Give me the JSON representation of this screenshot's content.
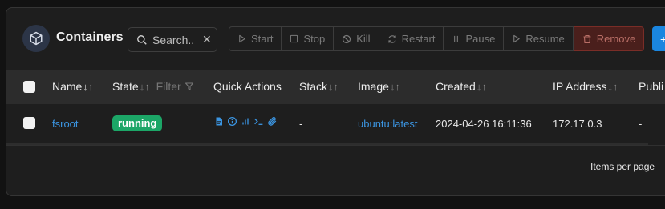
{
  "header": {
    "title": "Containers",
    "title_icon": "cube-icon",
    "search": {
      "placeholder": "Search..",
      "value": ""
    },
    "actions": [
      {
        "label": "Start",
        "icon": "play-icon"
      },
      {
        "label": "Stop",
        "icon": "square-icon"
      },
      {
        "label": "Kill",
        "icon": "ban-icon"
      },
      {
        "label": "Restart",
        "icon": "refresh-icon"
      },
      {
        "label": "Pause",
        "icon": "pause-icon"
      },
      {
        "label": "Resume",
        "icon": "play-icon"
      },
      {
        "label": "Remove",
        "icon": "trash-icon"
      }
    ],
    "add_button_icon": "plus-icon"
  },
  "table": {
    "columns": {
      "name": "Name",
      "state": "State",
      "state_filter": "Filter",
      "quick_actions": "Quick Actions",
      "stack": "Stack",
      "image": "Image",
      "created": "Created",
      "ip": "IP Address",
      "published": "Publi"
    },
    "rows": [
      {
        "name": "fsroot",
        "state": "running",
        "quick_actions": [
          "logs-icon",
          "inspect-icon",
          "stats-icon",
          "console-icon",
          "attach-icon"
        ],
        "stack": "-",
        "image": "ubuntu:latest",
        "created": "2024-04-26 16:11:36",
        "ip": "172.17.0.3",
        "published": "-"
      }
    ]
  },
  "footer": {
    "items_per_page_label": "Items per page"
  },
  "colors": {
    "accent": "#1a86e0",
    "running": "#1ca667",
    "remove": "#4a1f1c",
    "link": "#3b95e2"
  }
}
